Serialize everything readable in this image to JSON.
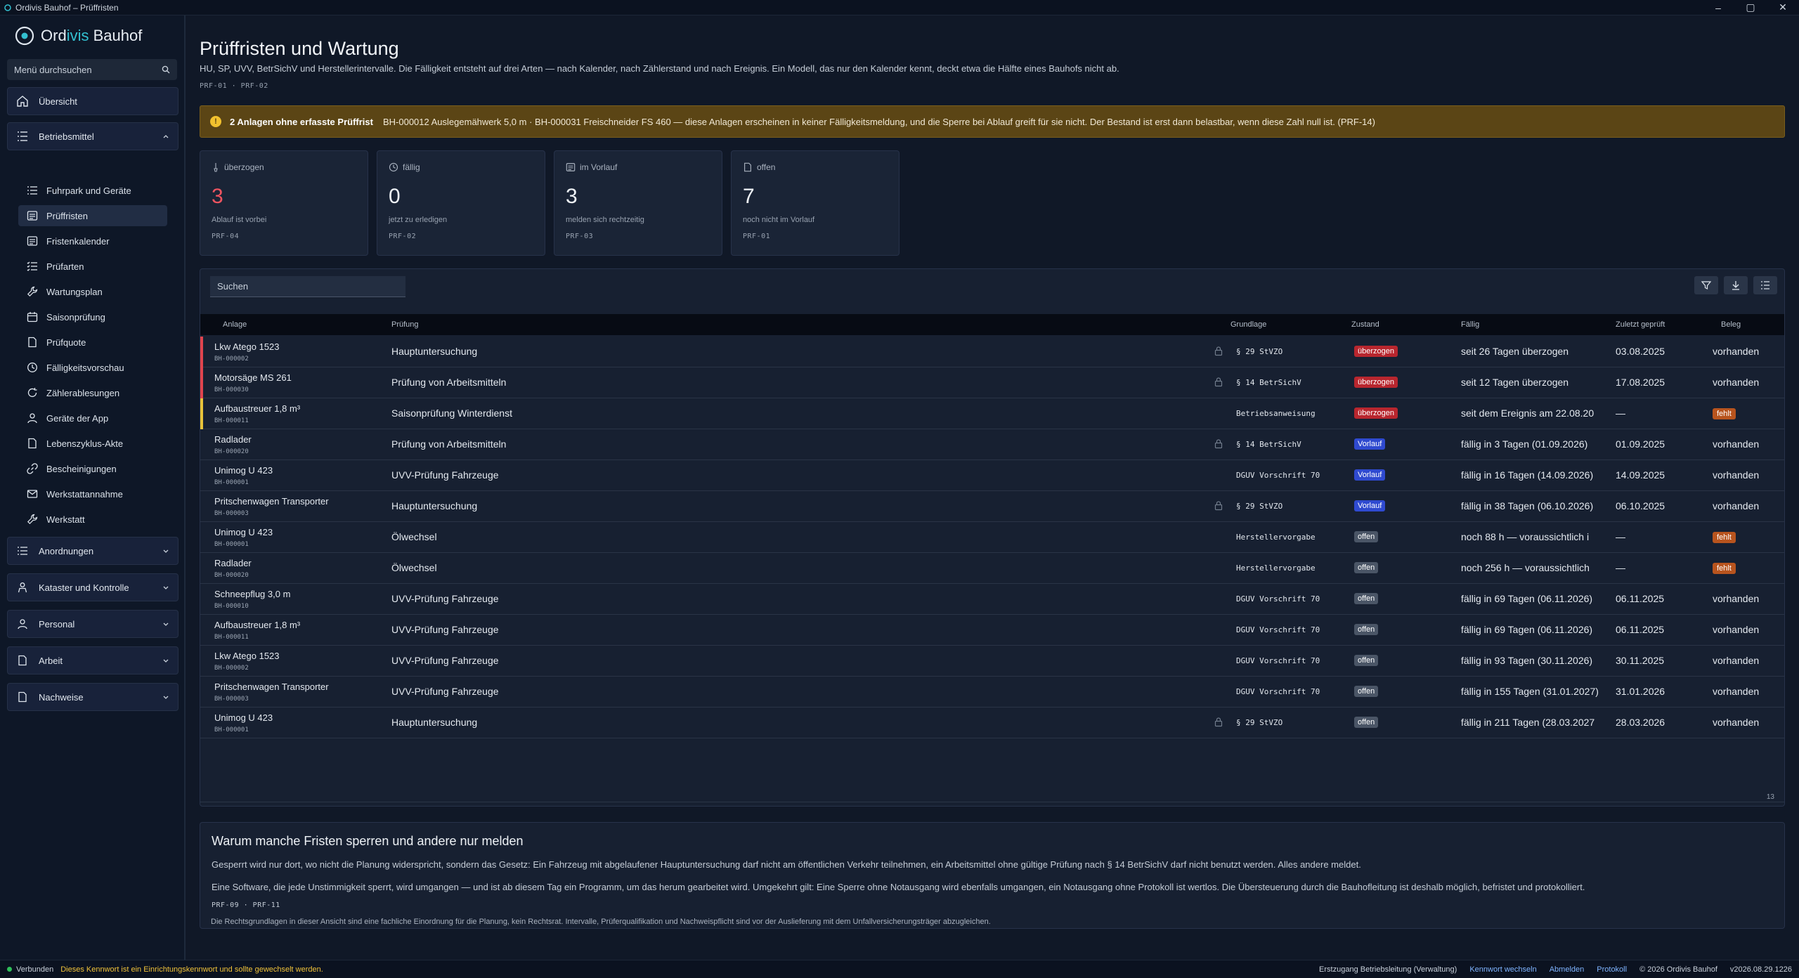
{
  "window": {
    "title": "Ordivis Bauhof – Prüffristen",
    "min": "–",
    "max": "▢",
    "close": "✕"
  },
  "brand": {
    "name_a": "Ord",
    "name_b": "ivis",
    "name_c": " Bauhof"
  },
  "sidebar": {
    "search_placeholder": "Menü durchsuchen",
    "overview": "Übersicht",
    "group_betrieb": "Betriebsmittel",
    "items": [
      {
        "label": "Fuhrpark und Geräte",
        "icon": "list-icon"
      },
      {
        "label": "Prüffristen",
        "icon": "calendar-list-icon"
      },
      {
        "label": "Fristenkalender",
        "icon": "calendar-list-icon"
      },
      {
        "label": "Prüfarten",
        "icon": "checklist-icon"
      },
      {
        "label": "Wartungsplan",
        "icon": "wrench-icon"
      },
      {
        "label": "Saisonprüfung",
        "icon": "calendar-icon"
      },
      {
        "label": "Prüfquote",
        "icon": "doc-icon"
      },
      {
        "label": "Fälligkeitsvorschau",
        "icon": "clock-icon"
      },
      {
        "label": "Zählerablesungen",
        "icon": "refresh-icon"
      },
      {
        "label": "Geräte der App",
        "icon": "user-icon"
      },
      {
        "label": "Lebenszyklus-Akte",
        "icon": "doc-icon"
      },
      {
        "label": "Bescheinigungen",
        "icon": "link-icon"
      },
      {
        "label": "Werkstattannahme",
        "icon": "mail-icon"
      },
      {
        "label": "Werkstatt",
        "icon": "wrench-icon"
      }
    ],
    "groups": [
      "Anordnungen",
      "Kataster und Kontrolle",
      "Personal",
      "Arbeit",
      "Nachweise"
    ]
  },
  "page": {
    "title": "Prüffristen und Wartung",
    "subtitle": "HU, SP, UVV, BetrSichV und Herstellerintervalle. Die Fälligkeit entsteht auf drei Arten — nach Kalender, nach Zählerstand und nach Ereignis. Ein Modell, das nur den Kalender kennt, deckt etwa die Hälfte eines Bauhofs nicht ab.",
    "refs": "PRF-01 · PRF-02"
  },
  "warning": {
    "bold": "2 Anlagen ohne erfasste Prüffrist",
    "text": "BH-000012 Auslegemähwerk 5,0 m · BH-000031 Freischneider FS 460 — diese Anlagen erscheinen in keiner Fälligkeitsmeldung, und die Sperre bei Ablauf greift für sie nicht. Der Bestand ist erst dann belastbar, wenn diese Zahl null ist. (PRF-14)"
  },
  "cards": [
    {
      "label": "überzogen",
      "value": "3",
      "note": "Ablauf ist vorbei",
      "ref": "PRF-04"
    },
    {
      "label": "fällig",
      "value": "0",
      "note": "jetzt zu erledigen",
      "ref": "PRF-02"
    },
    {
      "label": "im Vorlauf",
      "value": "3",
      "note": "melden sich rechtzeitig",
      "ref": "PRF-03"
    },
    {
      "label": "offen",
      "value": "7",
      "note": "noch nicht im Vorlauf",
      "ref": "PRF-01"
    }
  ],
  "table": {
    "search_placeholder": "Suchen",
    "headers": {
      "anlage": "Anlage",
      "pruefung": "Prüfung",
      "grundlage": "Grundlage",
      "zustand": "Zustand",
      "faellig": "Fällig",
      "zuletzt": "Zuletzt geprüft",
      "beleg": "Beleg"
    },
    "rows": [
      {
        "anlage": "Lkw Atego 1523",
        "id": "BH-000002",
        "pruefung": "Hauptuntersuchung",
        "lock": true,
        "grundlage": "§ 29 StVZO",
        "zustand": "überzogen",
        "faellig": "seit 26 Tagen überzogen",
        "zuletzt": "03.08.2025",
        "beleg": "vorhanden",
        "bar": "#e0444e"
      },
      {
        "anlage": "Motorsäge MS 261",
        "id": "BH-000030",
        "pruefung": "Prüfung von Arbeitsmitteln",
        "lock": true,
        "grundlage": "§ 14 BetrSichV",
        "zustand": "überzogen",
        "faellig": "seit 12 Tagen überzogen",
        "zuletzt": "17.08.2025",
        "beleg": "vorhanden",
        "bar": "#e0444e"
      },
      {
        "anlage": "Aufbaustreuer 1,8 m³",
        "id": "BH-000011",
        "pruefung": "Saisonprüfung Winterdienst",
        "lock": false,
        "grundlage": "Betriebsanweisung",
        "zustand": "überzogen",
        "faellig": "seit dem Ereignis am 22.08.20",
        "zuletzt": "—",
        "beleg": "fehlt",
        "bar": "#e8c33a"
      },
      {
        "anlage": "Radlader",
        "id": "BH-000020",
        "pruefung": "Prüfung von Arbeitsmitteln",
        "lock": true,
        "grundlage": "§ 14 BetrSichV",
        "zustand": "Vorlauf",
        "faellig": "fällig in 3 Tagen (01.09.2026)",
        "zuletzt": "01.09.2025",
        "beleg": "vorhanden",
        "bar": ""
      },
      {
        "anlage": "Unimog U 423",
        "id": "BH-000001",
        "pruefung": "UVV-Prüfung Fahrzeuge",
        "lock": false,
        "grundlage": "DGUV Vorschrift 70",
        "zustand": "Vorlauf",
        "faellig": "fällig in 16 Tagen (14.09.2026)",
        "zuletzt": "14.09.2025",
        "beleg": "vorhanden",
        "bar": ""
      },
      {
        "anlage": "Pritschenwagen Transporter",
        "id": "BH-000003",
        "pruefung": "Hauptuntersuchung",
        "lock": true,
        "grundlage": "§ 29 StVZO",
        "zustand": "Vorlauf",
        "faellig": "fällig in 38 Tagen (06.10.2026)",
        "zuletzt": "06.10.2025",
        "beleg": "vorhanden",
        "bar": ""
      },
      {
        "anlage": "Unimog U 423",
        "id": "BH-000001",
        "pruefung": "Ölwechsel",
        "lock": false,
        "grundlage": "Herstellervorgabe",
        "zustand": "offen",
        "faellig": "noch 88 h — voraussichtlich i",
        "zuletzt": "—",
        "beleg": "fehlt",
        "bar": ""
      },
      {
        "anlage": "Radlader",
        "id": "BH-000020",
        "pruefung": "Ölwechsel",
        "lock": false,
        "grundlage": "Herstellervorgabe",
        "zustand": "offen",
        "faellig": "noch 256 h — voraussichtlich",
        "zuletzt": "—",
        "beleg": "fehlt",
        "bar": ""
      },
      {
        "anlage": "Schneepflug 3,0 m",
        "id": "BH-000010",
        "pruefung": "UVV-Prüfung Fahrzeuge",
        "lock": false,
        "grundlage": "DGUV Vorschrift 70",
        "zustand": "offen",
        "faellig": "fällig in 69 Tagen (06.11.2026)",
        "zuletzt": "06.11.2025",
        "beleg": "vorhanden",
        "bar": ""
      },
      {
        "anlage": "Aufbaustreuer 1,8 m³",
        "id": "BH-000011",
        "pruefung": "UVV-Prüfung Fahrzeuge",
        "lock": false,
        "grundlage": "DGUV Vorschrift 70",
        "zustand": "offen",
        "faellig": "fällig in 69 Tagen (06.11.2026)",
        "zuletzt": "06.11.2025",
        "beleg": "vorhanden",
        "bar": ""
      },
      {
        "anlage": "Lkw Atego 1523",
        "id": "BH-000002",
        "pruefung": "UVV-Prüfung Fahrzeuge",
        "lock": false,
        "grundlage": "DGUV Vorschrift 70",
        "zustand": "offen",
        "faellig": "fällig in 93 Tagen (30.11.2026)",
        "zuletzt": "30.11.2025",
        "beleg": "vorhanden",
        "bar": ""
      },
      {
        "anlage": "Pritschenwagen Transporter",
        "id": "BH-000003",
        "pruefung": "UVV-Prüfung Fahrzeuge",
        "lock": false,
        "grundlage": "DGUV Vorschrift 70",
        "zustand": "offen",
        "faellig": "fällig in 155 Tagen (31.01.2027)",
        "zuletzt": "31.01.2026",
        "beleg": "vorhanden",
        "bar": ""
      },
      {
        "anlage": "Unimog U 423",
        "id": "BH-000001",
        "pruefung": "Hauptuntersuchung",
        "lock": true,
        "grundlage": "§ 29 StVZO",
        "zustand": "offen",
        "faellig": "fällig in 211 Tagen (28.03.2027",
        "zuletzt": "28.03.2026",
        "beleg": "vorhanden",
        "bar": ""
      }
    ],
    "count": "13"
  },
  "info": {
    "title": "Warum manche Fristen sperren und andere nur melden",
    "p1": "Gesperrt wird nur dort, wo nicht die Planung widerspricht, sondern das Gesetz: Ein Fahrzeug mit abgelaufener Hauptuntersuchung darf nicht am öffentlichen Verkehr teilnehmen, ein Arbeitsmittel ohne gültige Prüfung nach § 14 BetrSichV darf nicht benutzt werden. Alles andere meldet.",
    "p2": "Eine Software, die jede Unstimmigkeit sperrt, wird umgangen — und ist ab diesem Tag ein Programm, um das herum gearbeitet wird. Umgekehrt gilt: Eine Sperre ohne Notausgang wird ebenfalls umgangen, ein Notausgang ohne Protokoll ist wertlos. Die Übersteuerung durch die Bauhofleitung ist deshalb möglich, befristet und protokolliert.",
    "refs": "PRF-09 · PRF-11",
    "note": "Die Rechtsgrundlagen in dieser Ansicht sind eine fachliche Einordnung für die Planung, kein Rechtsrat. Intervalle, Prüferqualifikation und Nachweispflicht sind vor der Auslieferung mit dem Unfallversicherungsträger abzugleichen."
  },
  "status": {
    "connected": "Verbunden",
    "warning": "Dieses Kennwort ist ein Einrichtungskennwort und sollte gewechselt werden.",
    "user": "Erstzugang Betriebsleitung (Verwaltung)",
    "change_pw": "Kennwort wechseln",
    "logout": "Abmelden",
    "log": "Protokoll",
    "copyright": "© 2026 Ordivis Bauhof",
    "version": "v2026.08.29.1226"
  }
}
